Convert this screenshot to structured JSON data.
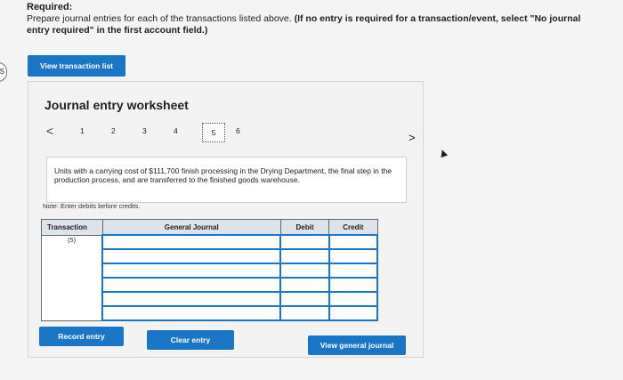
{
  "header": {
    "required_label": "Required:",
    "instruction_plain": "Prepare journal entries for each of the transactions listed above. ",
    "instruction_bold": "(If no entry is required for a transaction/event, select \"No journal entry required\" in the first account field.)"
  },
  "side_tab_label": "S",
  "view_transaction_list": "View transaction list",
  "worksheet": {
    "title": "Journal entry worksheet",
    "pages": [
      "1",
      "2",
      "3",
      "4",
      "5",
      "6"
    ],
    "active_page": "5",
    "prev_icon": "<",
    "next_icon": ">",
    "description": "Units with a carrying cost of $111,700 finish processing in the Drying Department, the final step in the production process, and are transferred to the finished goods warehouse.",
    "note": "Note: Enter debits before credits."
  },
  "table": {
    "headers": {
      "transaction": "Transaction",
      "general_journal": "General Journal",
      "debit": "Debit",
      "credit": "Credit"
    },
    "transaction_value": "(5)",
    "row_count": 6
  },
  "buttons": {
    "record": "Record entry",
    "clear": "Clear entry",
    "view_general": "View general journal"
  },
  "colors": {
    "accent": "#1a76c6",
    "header_bg": "#dde3ea"
  }
}
